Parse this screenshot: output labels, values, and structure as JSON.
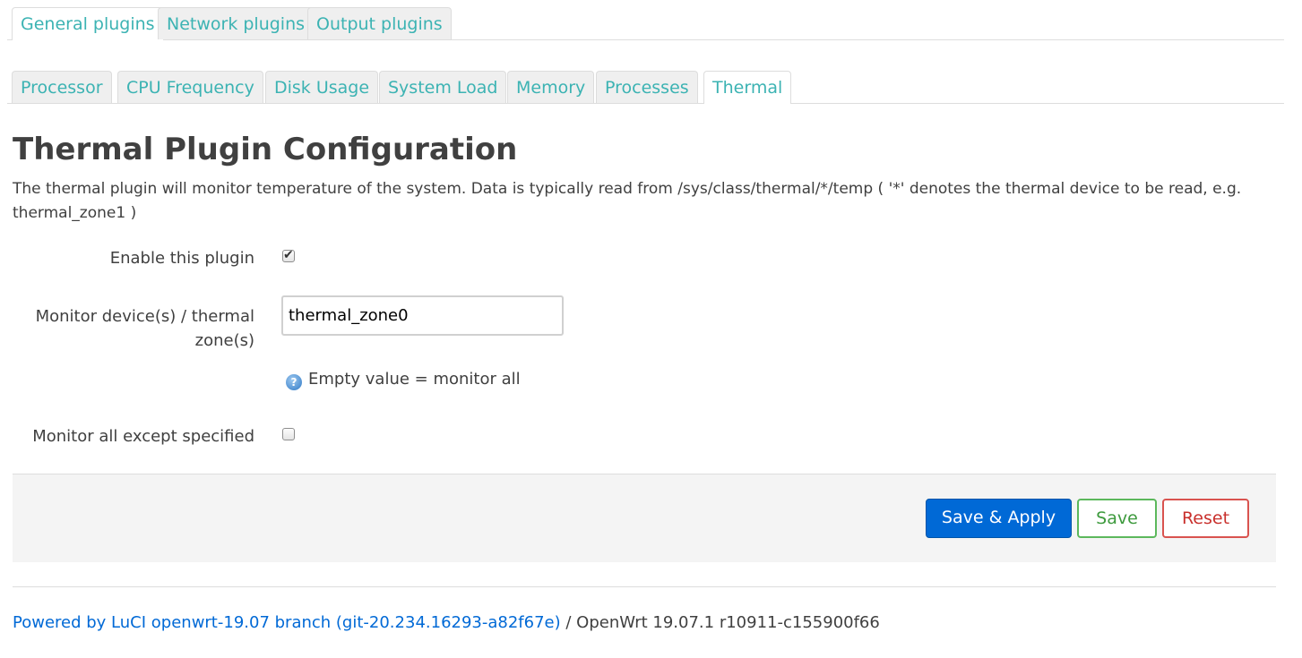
{
  "tabs": {
    "top": [
      {
        "label": "General plugins",
        "active": true
      },
      {
        "label": "Network plugins",
        "active": false
      },
      {
        "label": "Output plugins",
        "active": false
      }
    ],
    "sub": [
      {
        "label": "Processor",
        "active": false
      },
      {
        "label": "CPU Frequency",
        "active": false
      },
      {
        "label": "Disk Usage",
        "active": false
      },
      {
        "label": "System Load",
        "active": false
      },
      {
        "label": "Memory",
        "active": false
      },
      {
        "label": "Processes",
        "active": false
      },
      {
        "label": "Thermal",
        "active": true
      }
    ]
  },
  "page": {
    "title": "Thermal Plugin Configuration",
    "description": "The thermal plugin will monitor temperature of the system. Data is typically read from /sys/class/thermal/*/temp ( '*' denotes the thermal device to be read, e.g. thermal_zone1 )"
  },
  "form": {
    "enable": {
      "label": "Enable this plugin",
      "checked": true
    },
    "devices": {
      "label": "Monitor device(s) / thermal zone(s)",
      "value": "thermal_zone0",
      "hint": "Empty value = monitor all",
      "hint_icon": "help-icon"
    },
    "ignore_selected": {
      "label": "Monitor all except specified",
      "checked": false
    }
  },
  "actions": {
    "save_apply": "Save & Apply",
    "save": "Save",
    "reset": "Reset"
  },
  "footer": {
    "link": "Powered by LuCI openwrt-19.07 branch (git-20.234.16293-a82f67e)",
    "version": "/ OpenWrt 19.07.1 r10911-c155900f66"
  },
  "colors": {
    "tab_text": "#3cb3b3",
    "primary": "#0069d6",
    "save": "#5cb85c",
    "reset": "#d9534f"
  }
}
